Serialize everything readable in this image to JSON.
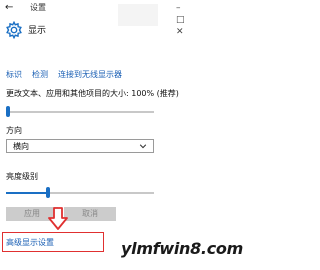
{
  "window": {
    "back_glyph": "←",
    "title": "设置",
    "controls": "–  □  ✕"
  },
  "page": {
    "title": "显示",
    "icon": "gear-icon"
  },
  "links": {
    "identify": "标识",
    "detect": "检测",
    "wireless": "连接到无线显示器"
  },
  "scale": {
    "label": "更改文本、应用和其他项目的大小: 100% (推荐)",
    "value_fraction": 0.0
  },
  "orientation": {
    "label": "方向",
    "selected": "横向"
  },
  "brightness": {
    "label": "亮度级别",
    "value_fraction": 0.28
  },
  "buttons": {
    "apply": "应用",
    "cancel": "取消"
  },
  "advanced": {
    "label": "高级显示设置"
  },
  "annotation": {
    "arrow_color": "#e03030",
    "highlight_color": "#e03030"
  },
  "watermark": "ylmfwin8.com",
  "colors": {
    "accent": "#1a6fc4",
    "link": "#1a5fb4"
  }
}
